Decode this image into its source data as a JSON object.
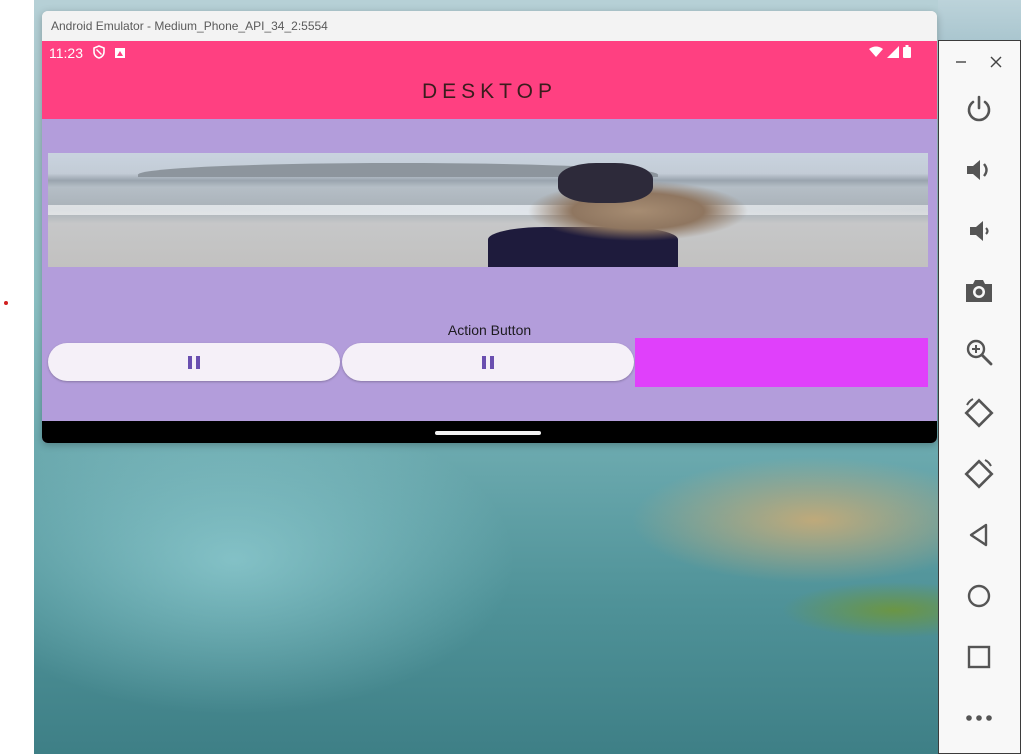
{
  "window": {
    "title": "Android Emulator - Medium_Phone_API_34_2:5554"
  },
  "status_bar": {
    "time": "11:23"
  },
  "app_bar": {
    "title": "DESKTOP"
  },
  "content": {
    "action_label": "Action Button",
    "buttons": [
      {
        "icon": "pause-icon"
      },
      {
        "icon": "pause-icon"
      }
    ]
  },
  "toolbar": {
    "controls": [
      "minimize",
      "close"
    ],
    "buttons": [
      "power",
      "volume-up",
      "volume-down",
      "screenshot",
      "zoom",
      "rotate-left",
      "rotate-right",
      "back",
      "home",
      "overview",
      "more"
    ]
  },
  "colors": {
    "app_bar": "#ff4081",
    "background": "#b39ddb",
    "magenta_box": "#e040fb",
    "toolbar_icon": "#555555"
  }
}
